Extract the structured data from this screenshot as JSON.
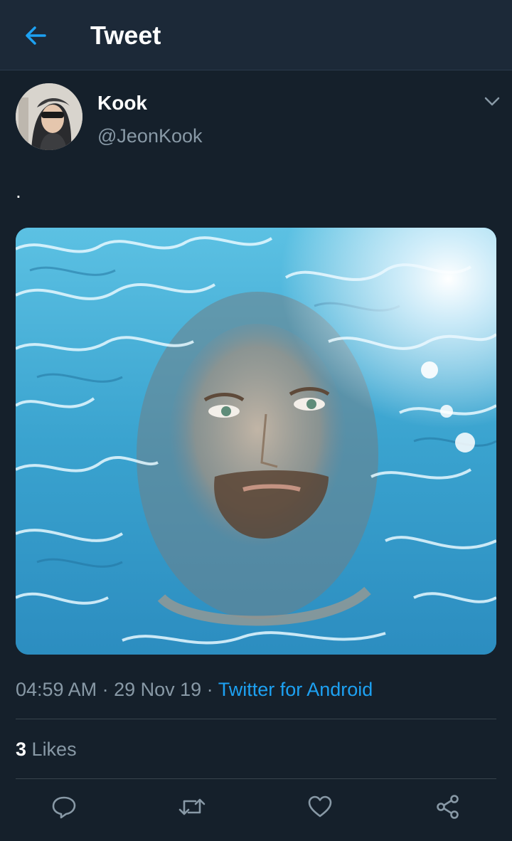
{
  "header": {
    "title": "Tweet",
    "back_icon": "arrow-left-icon"
  },
  "tweet": {
    "author": {
      "name": "Kook",
      "handle": "@JeonKook"
    },
    "text": ".",
    "timestamp": "04:59 AM",
    "date": "29 Nov 19",
    "source": "Twitter for Android",
    "separator": " · ",
    "likes_count": "3",
    "likes_label": "Likes"
  },
  "actions": [
    {
      "name": "reply",
      "icon": "reply-icon"
    },
    {
      "name": "retweet",
      "icon": "retweet-icon"
    },
    {
      "name": "like",
      "icon": "heart-icon"
    },
    {
      "name": "share",
      "icon": "share-icon"
    }
  ],
  "colors": {
    "background": "#15202b",
    "header": "#1c2938",
    "accent": "#1da1f2",
    "secondary_text": "#8899a6"
  }
}
